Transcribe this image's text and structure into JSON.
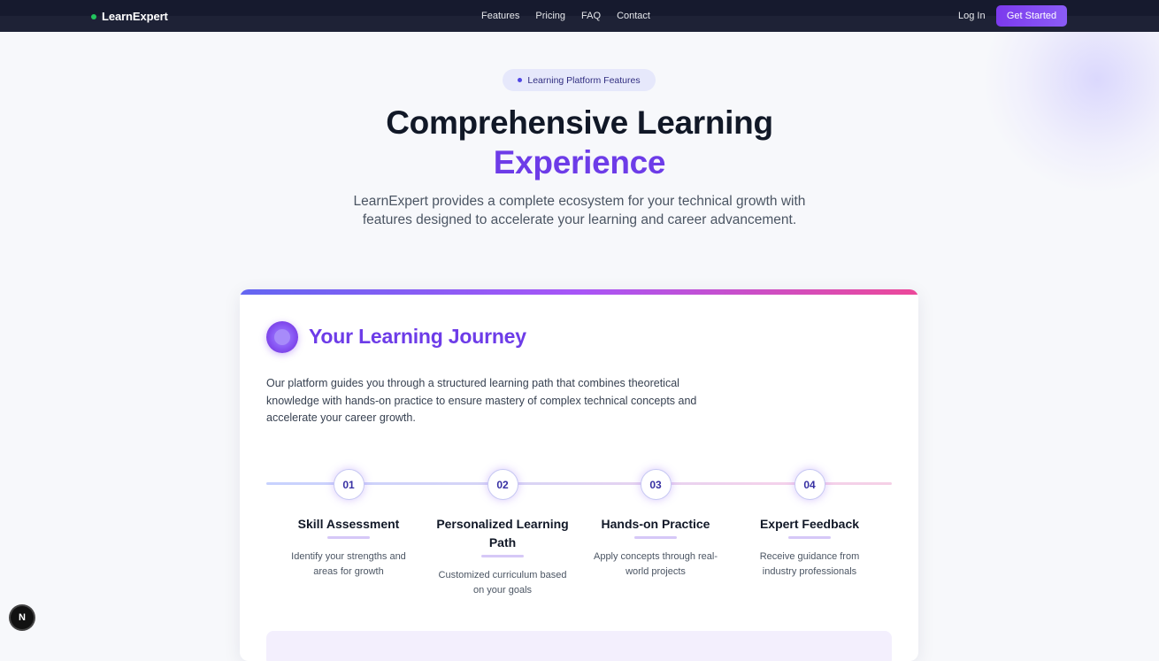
{
  "nav": {
    "brand": "LearnExpert",
    "links": [
      "Features",
      "Pricing",
      "FAQ",
      "Contact"
    ],
    "login": "Log In",
    "cta": "Get Started"
  },
  "hero": {
    "badge": "Learning Platform Features",
    "title_line1": "Comprehensive Learning",
    "title_line2": "Experience",
    "lead": "LearnExpert provides a complete ecosystem for your technical growth with features designed to accelerate your learning and career advancement."
  },
  "journey": {
    "title": "Your Learning Journey",
    "description": "Our platform guides you through a structured learning path that combines theoretical knowledge with hands-on practice to ensure mastery of complex technical concepts and accelerate your career growth.",
    "steps": [
      {
        "num": "01",
        "title": "Skill Assessment",
        "desc": "Identify your strengths and areas for growth"
      },
      {
        "num": "02",
        "title": "Personalized Learning Path",
        "desc": "Customized curriculum based on your goals"
      },
      {
        "num": "03",
        "title": "Hands-on Practice",
        "desc": "Apply concepts through real-world projects"
      },
      {
        "num": "04",
        "title": "Expert Feedback",
        "desc": "Receive guidance from industry professionals"
      }
    ]
  },
  "dev_badge": "N",
  "colors": {
    "accent": "#6d3ce8",
    "nav_bg": "#1e2236",
    "cta": "#7c3aed",
    "brand_dot": "#22c55e"
  }
}
